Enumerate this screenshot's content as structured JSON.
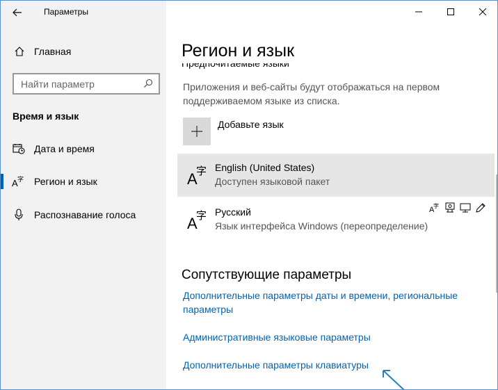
{
  "window": {
    "title": "Параметры",
    "controls": {
      "minimize": "—",
      "maximize": "☐",
      "close": "✕"
    }
  },
  "sidebar": {
    "back_icon": "arrow-left-icon",
    "home_label": "Главная",
    "search_placeholder": "Найти параметр",
    "section_heading": "Время и язык",
    "items": [
      {
        "label": "Дата и время",
        "icon": "calendar-clock-icon",
        "active": false
      },
      {
        "label": "Регион и язык",
        "icon": "language-icon",
        "active": true
      },
      {
        "label": "Распознавание голоса",
        "icon": "microphone-icon",
        "active": false
      }
    ]
  },
  "main": {
    "title": "Регион и язык",
    "partial_heading": "Предпочитаемые языки",
    "description": "Приложения и веб-сайты будут отображаться на первом поддерживаемом языке из списка.",
    "add_language_label": "Добавьте язык",
    "languages": [
      {
        "name": "English (United States)",
        "status": "Доступен языковой пакет",
        "selected": true
      },
      {
        "name": "Русский",
        "status": "Язык интерфейса Windows (переопределение)",
        "selected": false,
        "feature_icons": [
          "language-pack-icon",
          "speech-icon",
          "display-icon",
          "handwriting-icon"
        ]
      }
    ],
    "related_heading": "Сопутствующие параметры",
    "links": [
      "Дополнительные параметры даты и времени, региональные параметры",
      "Административные языковые параметры",
      "Дополнительные параметры клавиатуры"
    ]
  },
  "colors": {
    "accent": "#0063b1",
    "sidebar_bg": "#f2f2f2",
    "selected_row": "#e6e6e6",
    "annotation_arrow": "#2a7fb8"
  }
}
